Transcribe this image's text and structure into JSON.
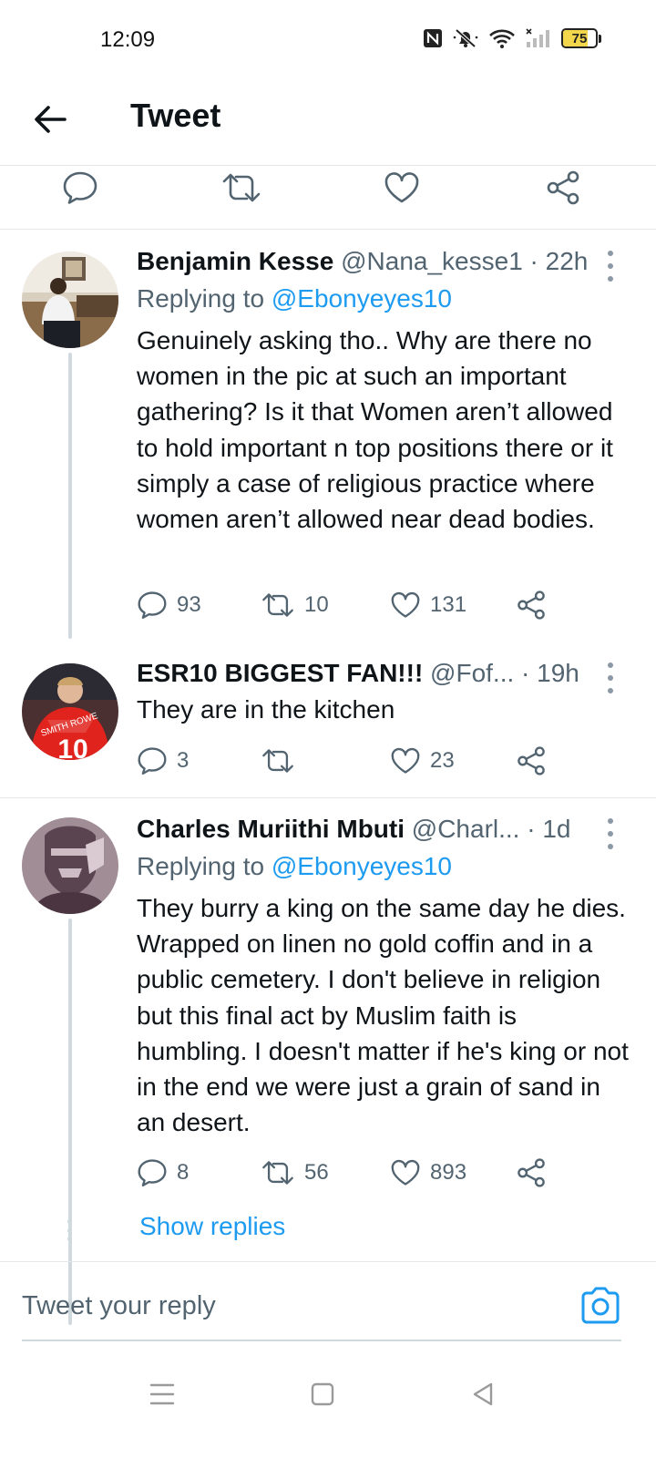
{
  "status_bar": {
    "time": "12:09",
    "battery": "75",
    "battery_level": 0.75,
    "icons": [
      "nfc-icon",
      "mute-icon",
      "wifi-icon",
      "signal-icon",
      "battery-icon"
    ]
  },
  "header": {
    "title": "Tweet",
    "back_icon": "arrow-left-icon"
  },
  "top_actions": [
    "reply-icon",
    "retweet-icon",
    "like-icon",
    "share-icon"
  ],
  "tweets": [
    {
      "name": "Benjamin Kesse",
      "handle": "@Nana_kesse1",
      "dot": "·",
      "time": "22h",
      "replying_prefix": "Replying to ",
      "replying_to": "@Ebonyeyes10",
      "text": "Genuinely asking tho.. Why are there no women in the pic at such an important gathering? Is it that Women aren’t allowed to hold important n top positions there or it simply a case of religious practice where women aren’t allowed near dead bodies.",
      "replies": "93",
      "retweets": "10",
      "likes": "131"
    },
    {
      "name": "ESR10 BIGGEST FAN!!!",
      "handle": "@Fof...",
      "dot": " ·",
      "time": "19h",
      "text": "They are in the kitchen",
      "replies": "3",
      "retweets": "",
      "likes": "23",
      "avatar_jersey_text": "SMITH ROWE",
      "avatar_jersey_number": "10"
    },
    {
      "name": "Charles Muriithi Mbuti",
      "handle": "@Charl...",
      "dot": " ·",
      "time": "1d",
      "replying_prefix": "Replying to ",
      "replying_to": "@Ebonyeyes10",
      "text": "They burry a king on the same day he dies. Wrapped on linen no gold coffin and in a public cemetery. I don't believe in religion but this final act by Muslim faith is humbling. I doesn't matter if he's king or not in the end we were just a grain of sand in an desert.",
      "replies": "8",
      "retweets": "56",
      "likes": "893"
    }
  ],
  "show_replies": "Show replies",
  "reply_box": {
    "placeholder": "Tweet your reply",
    "camera_icon": "camera-icon"
  },
  "nav_bar": [
    "menu-icon",
    "home-square-icon",
    "back-triangle-icon"
  ],
  "colors": {
    "accent": "#1d9bf0",
    "text_primary": "#0f1419",
    "text_secondary": "#536471",
    "divider": "#e4e8ea"
  }
}
